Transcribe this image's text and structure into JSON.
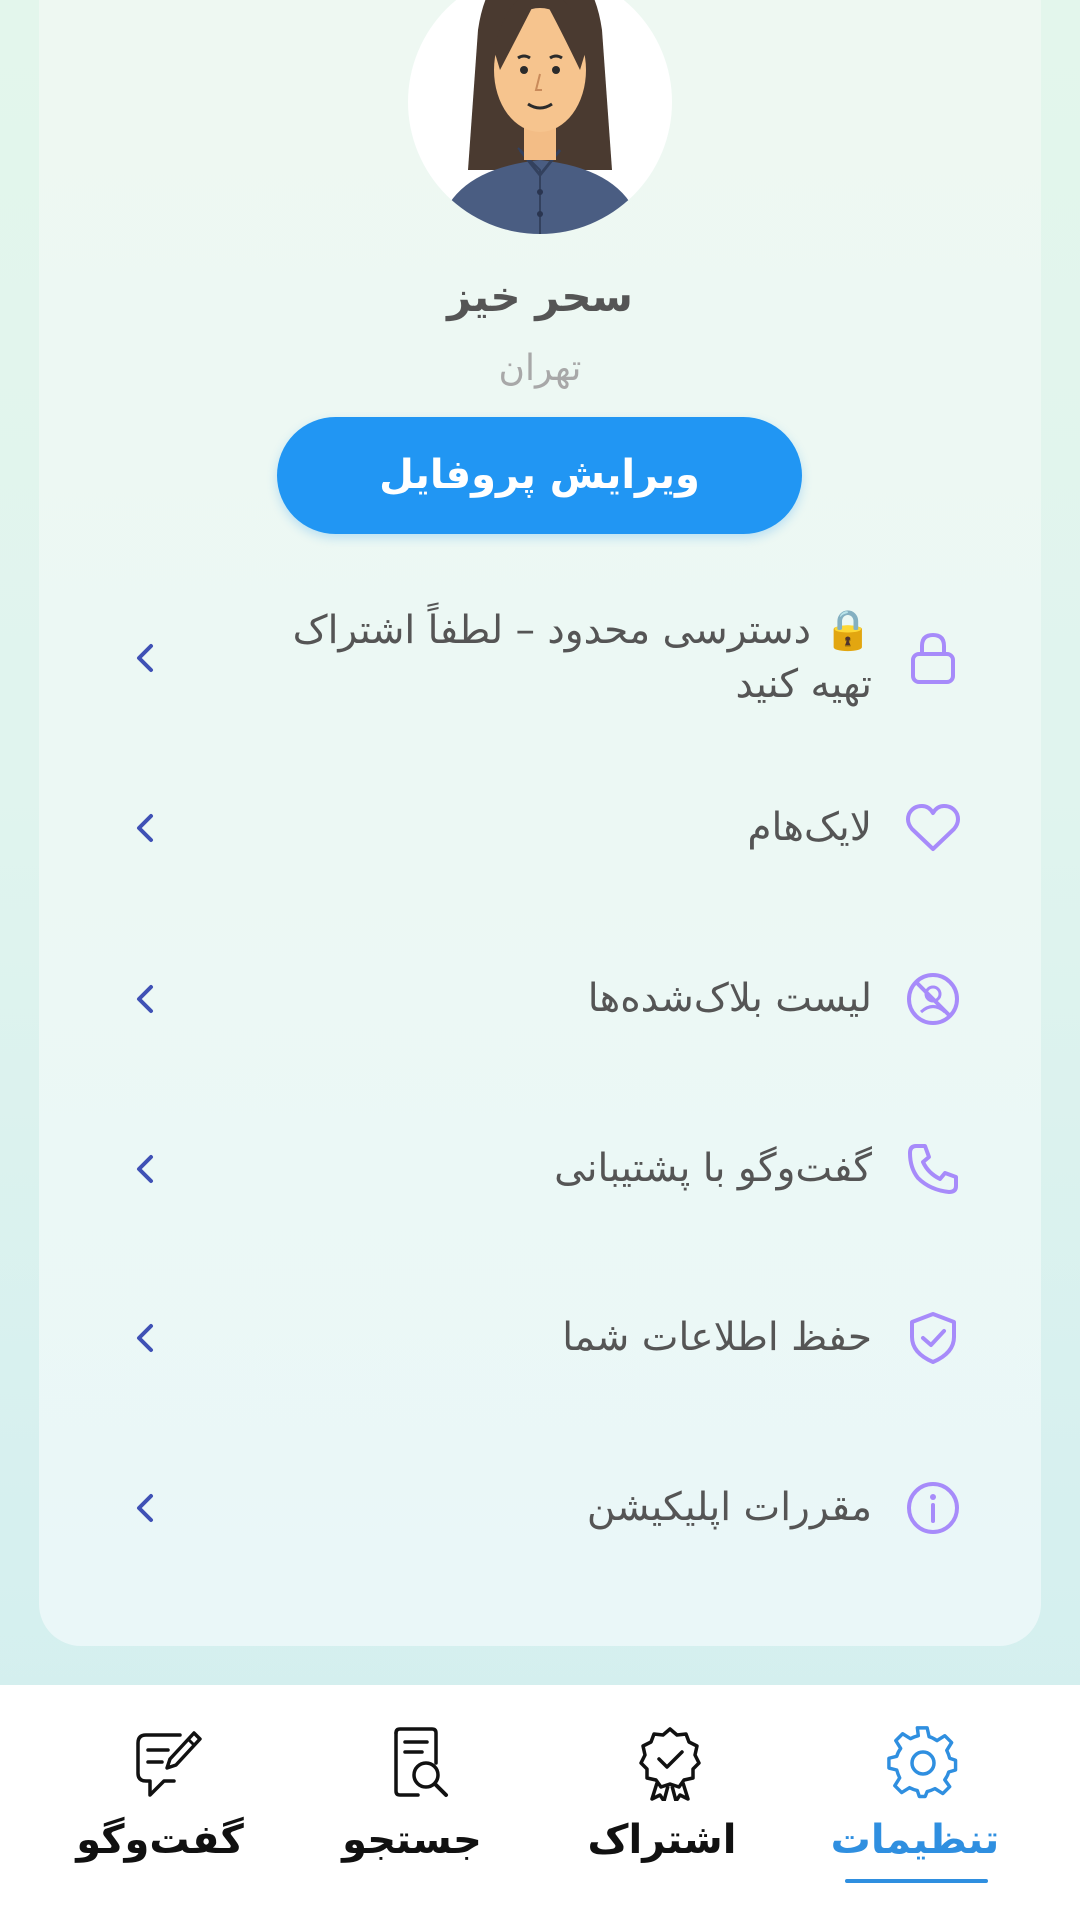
{
  "profile": {
    "name": "سحر خیز",
    "city": "تهران",
    "edit_button": "ویرایش پروفایل"
  },
  "menu": {
    "items": [
      {
        "label": "🔒 دسترسی محدود – لطفاً اشتراک تهیه کنید",
        "icon": "lock-icon"
      },
      {
        "label": "لایک‌هام",
        "icon": "heart-icon"
      },
      {
        "label": "لیست بلاک‌شده‌ها",
        "icon": "block-icon"
      },
      {
        "label": "گفت‌وگو با پشتیبانی",
        "icon": "phone-icon"
      },
      {
        "label": "حفظ اطلاعات شما",
        "icon": "shield-check-icon"
      },
      {
        "label": "مقررات اپلیکیشن",
        "icon": "info-icon"
      }
    ]
  },
  "bottom_nav": {
    "items": [
      {
        "label": "تنظیمات",
        "icon": "gear-icon",
        "active": true
      },
      {
        "label": "اشتراک",
        "icon": "badge-icon",
        "active": false
      },
      {
        "label": "جستجو",
        "icon": "document-search-icon",
        "active": false
      },
      {
        "label": "گفت‌وگو",
        "icon": "chat-edit-icon",
        "active": false
      }
    ]
  },
  "colors": {
    "accent": "#2196f3",
    "menu_icon": "#a78bfa",
    "chevron": "#3f51b5",
    "active_nav": "#2f8fe0"
  }
}
